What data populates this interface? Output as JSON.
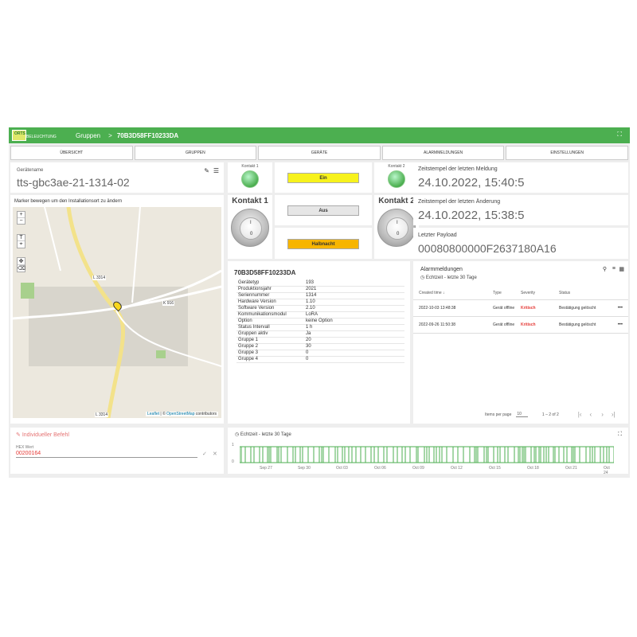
{
  "header": {
    "logo_short": "ORTS",
    "logo_long": "BELEUCHTUNG",
    "breadcrumb_parent": "Gruppen",
    "breadcrumb_sep": ">",
    "device_id": "70B3D58FF10233DA",
    "fullscreen_icon": "fullscreen-icon"
  },
  "nav": [
    "ÜBERSICHT",
    "GRUPPEN",
    "GERÄTE",
    "ALARMMELDUNGEN",
    "EINSTELLUNGEN"
  ],
  "device_name": {
    "label": "Gerätename",
    "value": "tts-gbc3ae-21-1314-02"
  },
  "map": {
    "title": "Marker bewegen um den Installationsort zu ändern",
    "zoom_in": "+",
    "zoom_out": "−",
    "road_label_1": "L 3314",
    "road_label_2": "K 916",
    "road_label_3": "L 3314",
    "attribution_leaflet": "Leaflet",
    "attribution_sep": " | © ",
    "attribution_osm": "OpenStreetMap",
    "attribution_tail": " contributors"
  },
  "controls": {
    "kontakt1_label": "Kontakt 1",
    "kontakt2_label": "Kontakt 2",
    "kontakt1_big": "Kontakt 1",
    "kontakt2_big": "Kontakt 2",
    "knob_on": "I",
    "knob_off": "0",
    "btn_ein": "Ein",
    "btn_aus": "Aus",
    "btn_halbnacht": "Halbnacht",
    "colors": {
      "ein": "#f7f21d",
      "aus": "#e6e6e6",
      "halbnacht": "#f7b500"
    }
  },
  "timestamps": {
    "last_msg_label": "Zeitstempel der letzten Meldung",
    "last_msg_value": "24.10.2022, 15:40:5",
    "last_change_label": "Zeitstempel der letzten Änderung",
    "last_change_value": "24.10.2022, 15:38:5",
    "payload_label": "Letzter Payload",
    "payload_value": "00080800000F2637180A16"
  },
  "device_info": {
    "title": "70B3D58FF10233DA",
    "rows": [
      [
        "Gerätetyp",
        "193"
      ],
      [
        "Produktionsjahr",
        "2021"
      ],
      [
        "Seriennummer",
        "1314"
      ],
      [
        "Hardware Version",
        "1.10"
      ],
      [
        "Software Version",
        "2.10"
      ],
      [
        "Kommunikationsmodul",
        "LoRA"
      ],
      [
        "Option",
        "keine Option"
      ],
      [
        "Status Intervall",
        "1 h"
      ],
      [
        "Gruppen aktiv",
        "Ja"
      ],
      [
        "Gruppe 1",
        "20"
      ],
      [
        "Gruppe 2",
        "30"
      ],
      [
        "Gruppe 3",
        "0"
      ],
      [
        "Gruppe 4",
        "0"
      ]
    ]
  },
  "alarms": {
    "title": "Alarmmeldungen",
    "subtitle": "Echtzeit - letzte 30 Tage",
    "columns": [
      "Created time ↓",
      "Type",
      "Severity",
      "Status"
    ],
    "rows": [
      {
        "time": "2022-10-03 13:48:38",
        "type": "Gerät offline",
        "severity": "Kritisch",
        "status": "Bestätigung gelöscht"
      },
      {
        "time": "2022-09-26 11:50:38",
        "type": "Gerät offline",
        "severity": "Kritisch",
        "status": "Bestätigung gelöscht"
      }
    ],
    "items_per_page_label": "Items per page",
    "items_per_page": "10",
    "range": "1 – 2 of 2",
    "more": "•••"
  },
  "command": {
    "title": "Individueller Befehl",
    "hex_label": "HEX Wert",
    "hex_value": "00200164",
    "ok": "✓",
    "cancel": "✕"
  },
  "timeline": {
    "subtitle": "Echtzeit - letzte 30 Tage",
    "y_top": "1",
    "y_bottom": "0",
    "ticks": [
      "Sep 27",
      "Sep 30",
      "Oct 03",
      "Oct 06",
      "Oct 09",
      "Oct 12",
      "Oct 15",
      "Oct 18",
      "Oct 21",
      "Oct 24"
    ],
    "color": "#4caf50"
  }
}
